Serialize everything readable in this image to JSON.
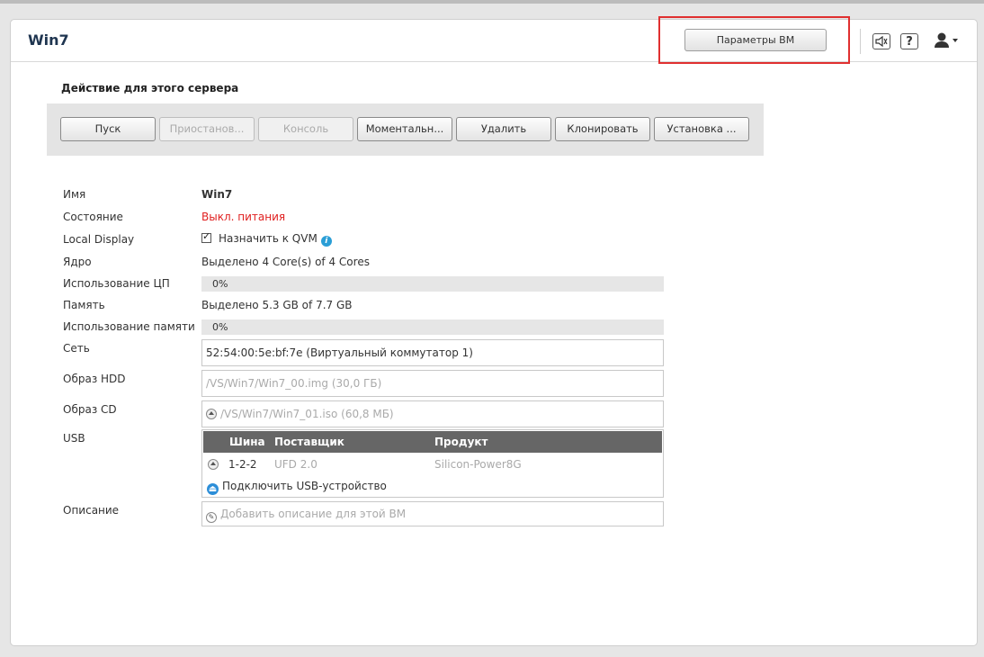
{
  "header": {
    "vm_name": "Win7",
    "params_button": "Параметры ВМ",
    "help_label": "?"
  },
  "actions": {
    "title": "Действие для этого сервера",
    "buttons": {
      "start": "Пуск",
      "suspend": "Приостанов...",
      "console": "Консоль",
      "snapshot": "Моментальн...",
      "delete": "Удалить",
      "clone": "Клонировать",
      "install": "Установка ..."
    }
  },
  "details": {
    "name_label": "Имя",
    "name_value": "Win7",
    "state_label": "Состояние",
    "state_value": "Выкл. питания",
    "local_display_label": "Local Display",
    "local_display_value": "Назначить к QVM",
    "local_display_checked": true,
    "core_label": "Ядро",
    "core_value": "Выделено 4 Core(s) of 4 Cores",
    "cpu_usage_label": "Использование ЦП",
    "cpu_usage_value": "0%",
    "memory_label": "Память",
    "memory_value": "Выделено 5.3 GB of 7.7 GB",
    "mem_usage_label": "Использование памяти",
    "mem_usage_value": "0%",
    "network_label": "Сеть",
    "network_value": "52:54:00:5e:bf:7e (Виртуальный коммутатор 1)",
    "hdd_label": "Образ HDD",
    "hdd_value": "/VS/Win7/Win7_00.img (30,0 ГБ)",
    "cd_label": "Образ CD",
    "cd_value": "/VS/Win7/Win7_01.iso (60,8 МБ)",
    "usb_label": "USB",
    "usb": {
      "columns": [
        "Шина",
        "Поставщик",
        "Продукт"
      ],
      "rows": [
        {
          "bus": "1-2-2",
          "vendor": "UFD 2.0",
          "product": "Silicon-Power8G"
        }
      ],
      "connect_label": "Подключить USB-устройство"
    },
    "description_label": "Описание",
    "description_placeholder": "Добавить описание для этой ВМ"
  },
  "colors": {
    "title": "#1f3550",
    "state_off": "#e02020",
    "highlight": "#e03030",
    "usb_header": "#666666"
  }
}
